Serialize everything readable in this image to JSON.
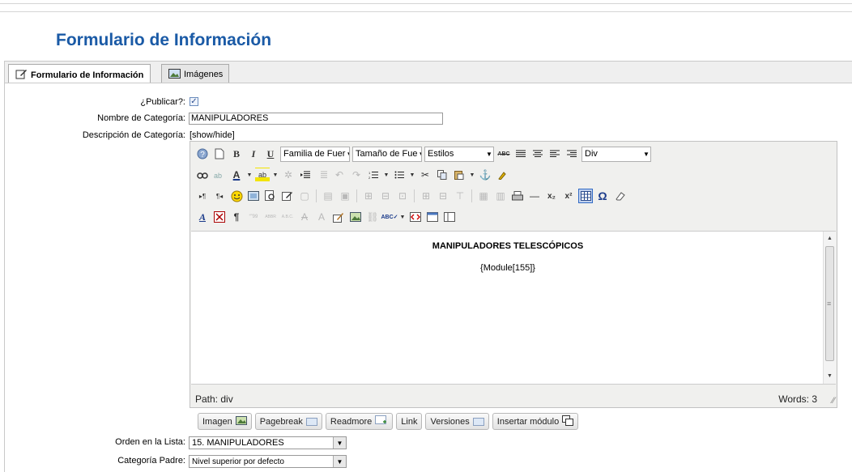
{
  "page": {
    "title": "Formulario de Información"
  },
  "tabs": [
    {
      "label": "Formulario de Información",
      "icon": "edit-form-icon",
      "active": true
    },
    {
      "label": "Imágenes",
      "icon": "image-icon",
      "active": false
    }
  ],
  "form": {
    "publish_label": "¿Publicar?:",
    "publish_checked": true,
    "category_name_label": "Nombre de Categoría:",
    "category_name_value": "MANIPULADORES",
    "description_label": "Descripción de Categoría:",
    "showhide_link": "[show/hide]",
    "order_label": "Orden en la Lista:",
    "order_value": "15. MANIPULADORES",
    "parent_label": "Categoría Padre:",
    "parent_value": "Nivel superior por defecto"
  },
  "editor": {
    "font_family": "Familia de Fuer",
    "font_size": "Tamaño de Fue",
    "styles": "Estilos",
    "format": "Div",
    "content_heading": "MANIPULADORES TELESCÓPICOS",
    "content_module": "{Module[155]}",
    "path": "Path: div",
    "words": "Words: 3",
    "icons": {
      "bold": "B",
      "italic": "I",
      "underline": "U",
      "help": "?",
      "new": "▯",
      "strike": "ABC",
      "fontcolor": "A",
      "bgcolor": "ab",
      "pilcrow": "¶",
      "hr": "—",
      "sub": "x₂",
      "sup": "x²",
      "omega": "Ω",
      "cut": "✂",
      "anchor": "⚓",
      "find": "🔍",
      "smiley": "☺"
    }
  },
  "xtd_buttons": [
    {
      "label": "Imagen"
    },
    {
      "label": "Pagebreak"
    },
    {
      "label": "Readmore"
    },
    {
      "label": "Link"
    },
    {
      "label": "Versiones"
    },
    {
      "label": "Insertar módulo"
    }
  ]
}
